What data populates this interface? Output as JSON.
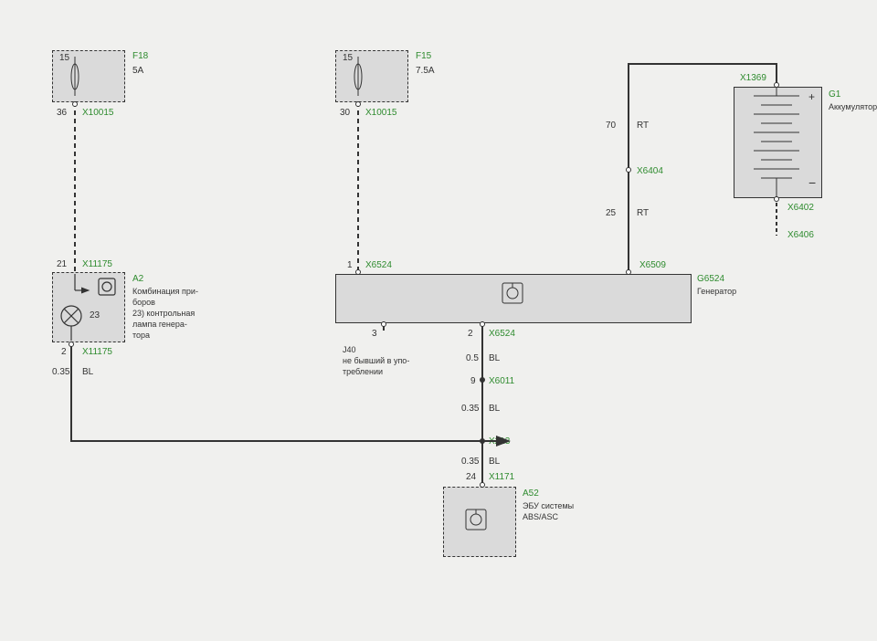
{
  "fuse1": {
    "id": "F18",
    "rating": "5A",
    "pin": "15",
    "out_pin": "36",
    "conn": "X10015"
  },
  "fuse2": {
    "id": "F15",
    "rating": "7.5A",
    "pin": "15",
    "out_pin": "30",
    "conn": "X10015"
  },
  "battery": {
    "id": "G1",
    "name": "Аккумуляторы",
    "conn_top": "X1369",
    "conn_bottom": "X6402",
    "gnd": "X6406"
  },
  "cluster": {
    "id": "A2",
    "name_l1": "Комбинация при-",
    "name_l2": "боров",
    "name_l3": "23) контрольная",
    "name_l4": "лампа генера-",
    "name_l5": "тора",
    "in_pin": "21",
    "out_pin": "2",
    "inner": "23",
    "conn": "X11175"
  },
  "generator": {
    "id": "G6524",
    "name": "Генератор",
    "conn_left": "X6524",
    "pin_left": "1",
    "conn_right": "X6509",
    "pin_out_left": "3",
    "pin_out_right": "2",
    "conn_out": "X6524"
  },
  "j40": {
    "id": "J40",
    "l1": "не бывший в упо-",
    "l2": "треблении"
  },
  "wire_bl1": {
    "gauge": "0.35",
    "color": "BL"
  },
  "wire_bl2": {
    "gauge": "0.5",
    "color": "BL"
  },
  "wire_bl3": {
    "gauge": "0.35",
    "color": "BL"
  },
  "wire_bl4": {
    "gauge": "0.35",
    "color": "BL"
  },
  "wire_rt1": {
    "gauge": "70",
    "color": "RT"
  },
  "wire_rt2": {
    "gauge": "25",
    "color": "RT"
  },
  "x6404": "X6404",
  "x6011": {
    "id": "X6011",
    "pin": "9"
  },
  "x213": "X213",
  "x1171": {
    "id": "X1171",
    "pin": "24"
  },
  "ecu": {
    "id": "A52",
    "name_l1": "ЭБУ системы",
    "name_l2": "ABS/ASC"
  }
}
